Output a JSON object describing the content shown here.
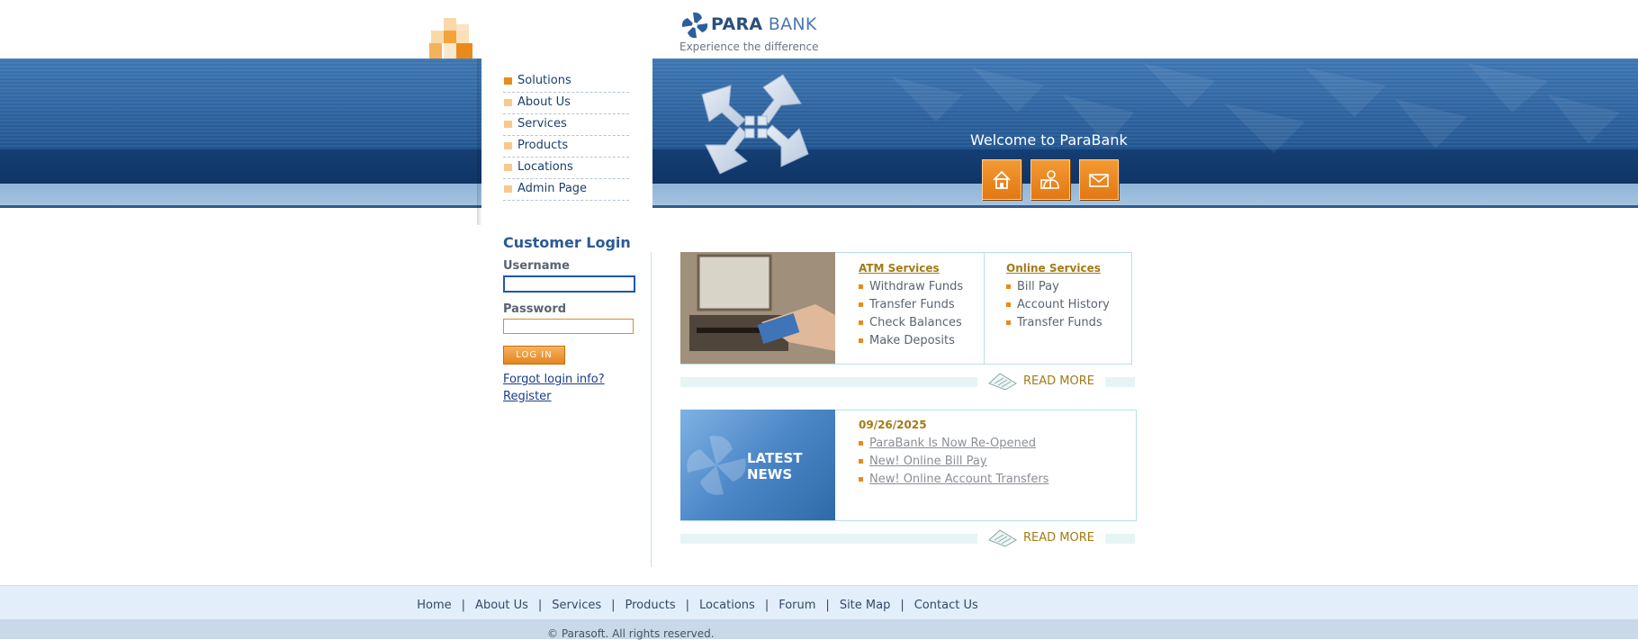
{
  "brand": {
    "name_bold": "PARA",
    "name_light": "BANK",
    "tagline": "Experience the difference"
  },
  "main_nav": [
    {
      "label": "Solutions"
    },
    {
      "label": "About Us"
    },
    {
      "label": "Services"
    },
    {
      "label": "Products"
    },
    {
      "label": "Locations"
    },
    {
      "label": "Admin Page"
    }
  ],
  "hero": {
    "welcome": "Welcome to ParaBank",
    "buttons": [
      "home-icon",
      "contact-icon",
      "mail-icon"
    ]
  },
  "login": {
    "title": "Customer Login",
    "username_label": "Username",
    "username_value": "",
    "password_label": "Password",
    "password_value": "",
    "button_label": "LOG IN",
    "forgot_link": "Forgot login info?",
    "register_link": "Register"
  },
  "services": {
    "atm": {
      "heading": "ATM Services",
      "items": [
        "Withdraw Funds",
        "Transfer Funds",
        "Check Balances",
        "Make Deposits"
      ]
    },
    "online": {
      "heading": "Online Services",
      "items": [
        "Bill Pay",
        "Account History",
        "Transfer Funds"
      ]
    },
    "read_more": "READ MORE"
  },
  "news": {
    "image_label_1": "LATEST",
    "image_label_2": "NEWS",
    "date": "09/26/2025",
    "items": [
      "ParaBank Is Now Re-Opened",
      "New! Online Bill Pay",
      "New! Online Account Transfers"
    ],
    "read_more": "READ MORE"
  },
  "footer": {
    "links": [
      "Home",
      "About Us",
      "Services",
      "Products",
      "Locations",
      "Forum",
      "Site Map",
      "Contact Us"
    ],
    "copyright": "© Parasoft. All rights reserved."
  },
  "colors": {
    "accent_orange": "#ea8a1b",
    "brand_blue": "#2b4f7e",
    "gold_text": "#a37b14"
  }
}
